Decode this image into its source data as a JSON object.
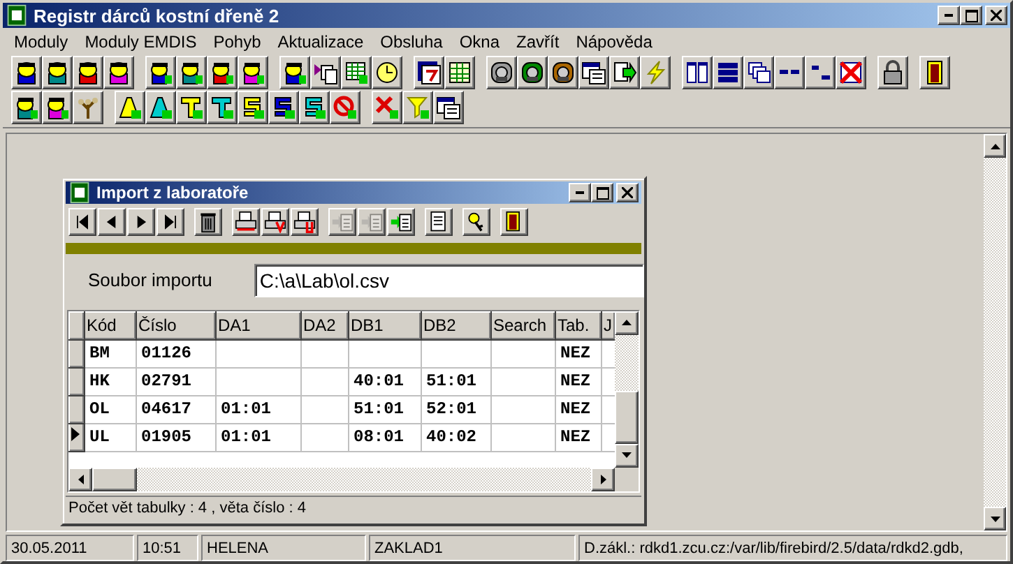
{
  "window": {
    "title": "Registr dárců kostní dřeně 2"
  },
  "menu": [
    "Moduly",
    "Moduly EMDIS",
    "Pohyb",
    "Aktualizace",
    "Obsluha",
    "Okna",
    "Zavřít",
    "Nápověda"
  ],
  "child_window": {
    "title": "Import z laboratoře",
    "toolbar": [
      {
        "disabled": false
      },
      {
        "disabled": false
      },
      {
        "disabled": false
      },
      {
        "disabled": false
      },
      {
        "disabled": false
      },
      {
        "disabled": false
      },
      {
        "disabled": false
      },
      {
        "disabled": false
      },
      {
        "disabled": true
      },
      {
        "disabled": true
      },
      {
        "disabled": false
      },
      {
        "disabled": false
      },
      {
        "disabled": false
      },
      {
        "disabled": false
      }
    ],
    "import_file": {
      "label": "Soubor importu",
      "value": "C:\\a\\Lab\\ol.csv"
    },
    "table": {
      "columns": [
        "Kód",
        "Číslo",
        "DA1",
        "DA2",
        "DB1",
        "DB2",
        "Search",
        "Tab.",
        "J"
      ],
      "rows": [
        {
          "selected": false,
          "cells": [
            "BM",
            "01126",
            null,
            null,
            null,
            null,
            null,
            "NEZ",
            null
          ]
        },
        {
          "selected": false,
          "cells": [
            "HK",
            "02791",
            null,
            null,
            "40:01",
            "51:01",
            null,
            "NEZ",
            null
          ]
        },
        {
          "selected": false,
          "cells": [
            "OL",
            "04617",
            "01:01",
            null,
            "51:01",
            "52:01",
            null,
            "NEZ",
            null
          ]
        },
        {
          "selected": true,
          "cells": [
            "UL",
            "01905",
            "01:01",
            null,
            "08:01",
            "40:02",
            null,
            "NEZ",
            null
          ]
        }
      ]
    },
    "status": "Počet vět tabulky : 4 , věta číslo : 4"
  },
  "status_bar": [
    "30.05.2011",
    "10:51",
    "HELENA",
    "ZAKLAD1",
    "D.zákl.: rdkd1.zcu.cz:/var/lib/firebird/2.5/data/rdkd2.gdb,"
  ]
}
